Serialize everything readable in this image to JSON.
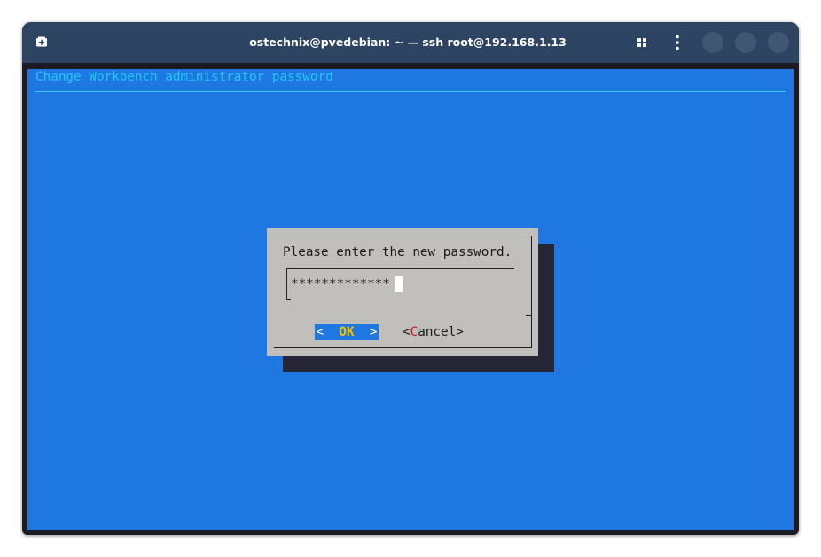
{
  "window": {
    "title": "ostechnix@pvedebian: ~ — ssh root@192.168.1.13",
    "icons": {
      "new_tab": "new-tab-icon",
      "grid": "grid-view-icon",
      "menu": "kebab-menu-icon"
    },
    "colors": {
      "titlebar": "#2d4462",
      "window_button": "#415671"
    }
  },
  "terminal": {
    "screen_title": "Change Workbench administrator password",
    "colors": {
      "background": "#1f78e2",
      "title_text": "#23c8f4"
    }
  },
  "dialog": {
    "prompt": "Please enter the new password.",
    "password_masked": "*************",
    "ok": {
      "left": "<  ",
      "hotkey": "OK",
      "right": "  >"
    },
    "cancel": {
      "left": "<",
      "hotkey": "C",
      "rest": "ancel>"
    },
    "colors": {
      "background": "#c1bfbb",
      "shadow": "#262637",
      "ok_hotkey": "#f5c400",
      "cancel_hotkey": "#c41a1a"
    }
  }
}
